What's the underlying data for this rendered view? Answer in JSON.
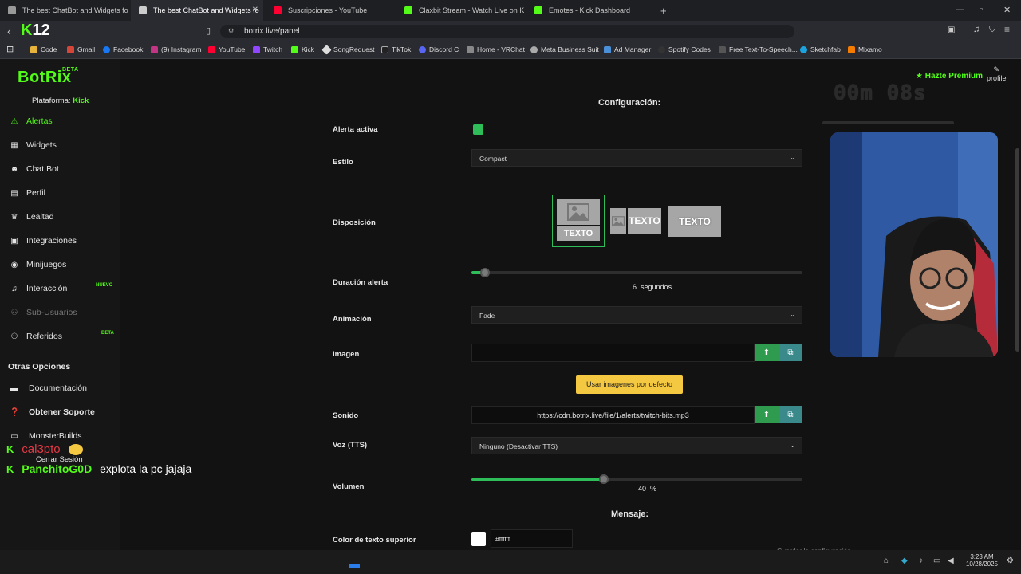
{
  "browser": {
    "tabs": [
      {
        "title": "The best ChatBot and Widgets fo",
        "active": false
      },
      {
        "title": "The best ChatBot and Widgets fo",
        "active": true
      },
      {
        "title": "Suscripciones - YouTube",
        "active": false
      },
      {
        "title": "Claxbit Stream - Watch Live on K",
        "active": false
      },
      {
        "title": "Emotes - Kick Dashboard",
        "active": false
      }
    ],
    "logo_number": "12",
    "url": "botrix.live/panel",
    "bookmarks": [
      "Code",
      "Gmail",
      "Facebook",
      "(9) Instagram",
      "YouTube",
      "Twitch",
      "Kick",
      "SongRequest",
      "TikTok",
      "Discord C",
      "Home - VRChat",
      "Meta Business Suit",
      "Ad Manager",
      "Spotify Codes",
      "Free Text-To-Speech...",
      "Sketchfab",
      "Mixamo"
    ]
  },
  "sidebar": {
    "brand": "BotRix",
    "brand_badge": "BETA",
    "platform_label": "Plataforma:",
    "platform_value": "Kick",
    "items": [
      {
        "label": "Alertas",
        "icon": "warning-icon"
      },
      {
        "label": "Widgets",
        "icon": "grid-icon"
      },
      {
        "label": "Chat Bot",
        "icon": "robot-icon"
      },
      {
        "label": "Perfil",
        "icon": "id-card-icon"
      },
      {
        "label": "Lealtad",
        "icon": "trophy-icon"
      },
      {
        "label": "Integraciones",
        "icon": "integration-icon"
      },
      {
        "label": "Minijuegos",
        "icon": "gamepad-icon"
      },
      {
        "label": "Interacción",
        "icon": "music-icon",
        "badge": "NUEVO"
      },
      {
        "label": "Sub-Usuarios",
        "icon": "users-icon"
      },
      {
        "label": "Referidos",
        "icon": "users-icon",
        "badge": "BETA"
      }
    ],
    "other_heading": "Otras Opciones",
    "other_items": [
      {
        "label": "Documentación",
        "icon": "book-icon"
      },
      {
        "label": "Obtener Soporte",
        "icon": "help-icon"
      },
      {
        "label": "MonsterBuilds",
        "icon": "monitor-icon"
      },
      {
        "label": "Cerrar Sesión",
        "icon": "logout-icon"
      }
    ]
  },
  "topbar": {
    "premium": "Hazte Premium",
    "profile": "profile"
  },
  "config": {
    "heading": "Configuración:",
    "alerta_activa": "Alerta activa",
    "estilo": "Estilo",
    "estilo_value": "Compact",
    "disposicion": "Disposición",
    "layout_text": "TEXTO",
    "duracion": "Duración alerta",
    "duracion_value": "6",
    "duracion_unit": "segundos",
    "duracion_fraction": 0.04,
    "animacion": "Animación",
    "animacion_value": "Fade",
    "imagen": "Imagen",
    "imagen_value": "",
    "default_images_button": "Usar imagenes por defecto",
    "sonido": "Sonido",
    "sonido_value": "https://cdn.botrix.live/file/1/alerts/twitch-bits.mp3",
    "voz": "Voz (TTS)",
    "voz_value": "Ninguno (Desactivar TTS)",
    "volumen": "Volumen",
    "volumen_value": "40",
    "volumen_unit": "%",
    "volumen_fraction": 0.4,
    "mensaje_heading": "Mensaje:",
    "color_superior": "Color de texto superior",
    "color_value": "#ffffff",
    "save_button": "Guardar la configuración"
  },
  "overlay": {
    "timer": "00m 08s",
    "chat": [
      {
        "user": "cal3pto",
        "message": ""
      },
      {
        "user": "PanchitoG0D",
        "message": "explota la pc jajaja"
      }
    ]
  },
  "taskbar": {
    "time": "3:23 AM",
    "date": "10/28/2025"
  },
  "colors": {
    "accent": "#53fc18",
    "yellow": "#f5c842",
    "green_btn": "#2e9b4e",
    "teal_btn": "#3a8a8c"
  }
}
